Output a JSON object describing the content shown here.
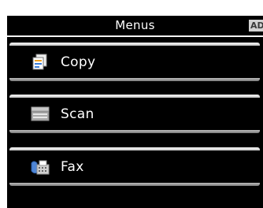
{
  "header": {
    "title": "Menus",
    "badge": "AD"
  },
  "menu": {
    "items": [
      {
        "label": "Copy",
        "icon": "copy-icon"
      },
      {
        "label": "Scan",
        "icon": "scan-icon"
      },
      {
        "label": "Fax",
        "icon": "fax-icon"
      }
    ]
  },
  "colors": {
    "background": "#000000",
    "text": "#ffffff",
    "bar": "#d8d8d8"
  }
}
